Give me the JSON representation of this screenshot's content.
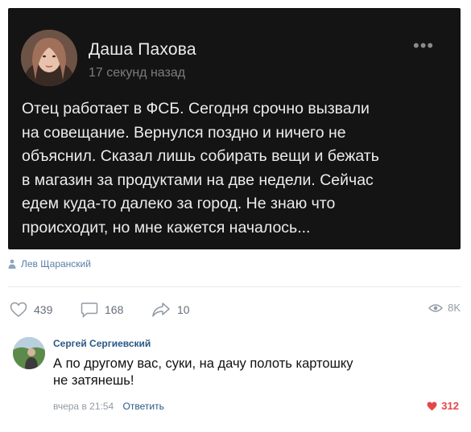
{
  "post": {
    "author_name": "Даша Пахова",
    "time": "17 секунд назад",
    "more_label": "•••",
    "text_lines": [
      "Отец работает в ФСБ. Сегодня срочно вызвали",
      "на совещание. Вернулся поздно и ничего не",
      "объяснил. Сказал лишь собирать вещи и бежать",
      "в магазин за продуктами на две недели. Сейчас",
      "едем куда-то далеко за город. Не знаю что",
      "происходит, но мне кажется началось..."
    ]
  },
  "attribution": {
    "name": "Лев Щаранский"
  },
  "actions": {
    "likes": "439",
    "comments": "168",
    "shares": "10",
    "views": "8K"
  },
  "comment": {
    "author": "Сергей Сергиевский",
    "text_lines": [
      "А по другому вас, суки, на дачу полоть картошку",
      "не затянешь!"
    ],
    "time": "вчера в 21:54",
    "reply_label": "Ответить",
    "likes": "312"
  },
  "colors": {
    "card_bg": "#141414",
    "link": "#2a5885",
    "like_red": "#e64646"
  }
}
